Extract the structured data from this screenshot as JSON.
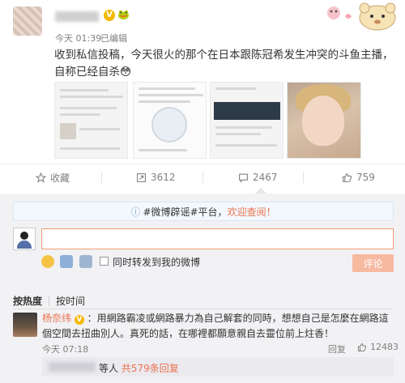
{
  "post": {
    "time": "今天 01:39",
    "edited": "已编辑",
    "text": "收到私信投稿，今天很火的那个在日本跟陈冠希发生冲突的斗鱼主播，自称已经自杀😳",
    "vip_badge": "V",
    "level_icon": "🐸"
  },
  "actions": {
    "favorite": {
      "label": "收藏",
      "icon": "star-icon"
    },
    "repost": {
      "count": "3612",
      "icon": "repost-icon"
    },
    "comment": {
      "count": "2467",
      "icon": "comment-icon"
    },
    "like": {
      "count": "759",
      "icon": "thumbs-up-icon"
    }
  },
  "comment_box": {
    "notice_prefix": "#微博辟谣#平台，",
    "notice_link": "欢迎查阅！",
    "also_repost_label": "同时转发到我的微博",
    "submit_label": "评论"
  },
  "sort": {
    "by_hot": "按热度",
    "by_time": "按时间"
  },
  "top_comment": {
    "user": "杨奈纬",
    "badge": "V",
    "text": "：用網路霸凌或網路暴力為自己解套的同時，想想自己是怎麼在網路這個空間去扭曲別人。真死的話，在哪裡都願意親自去靈位前上炷香！",
    "time": "今天 07:18",
    "reply_label": "回复",
    "likes": "12483",
    "replies_prefix": "等人",
    "replies_link": "共579条回复"
  },
  "colors": {
    "accent": "#eb7350",
    "muted": "#808080",
    "comment_bg": "#f2f2f5"
  }
}
